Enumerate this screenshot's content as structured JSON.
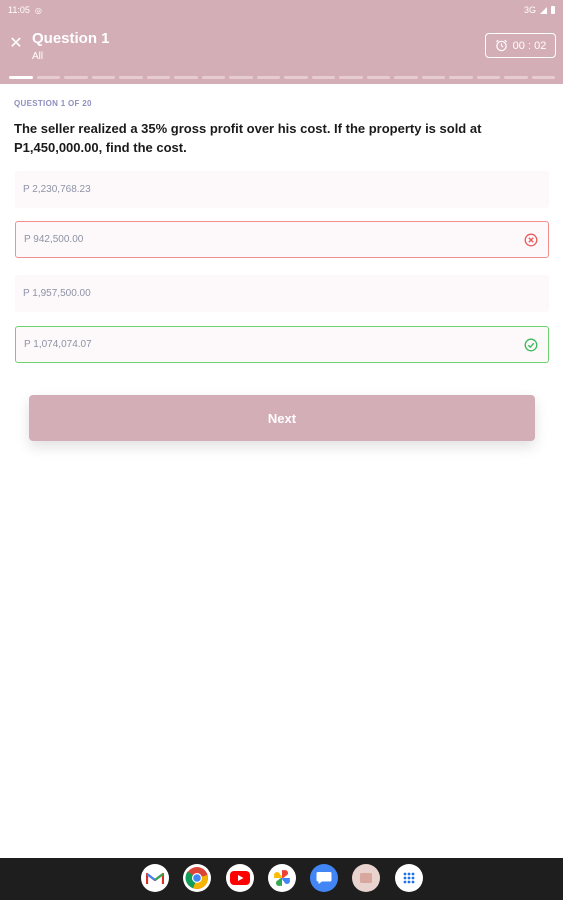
{
  "status_bar": {
    "time": "11:05",
    "network": "3G"
  },
  "header": {
    "title": "Question 1",
    "subtitle": "All",
    "timer": "00 : 02"
  },
  "progress": {
    "current": 1,
    "total": 20
  },
  "question": {
    "counter": "QUESTION 1 OF 20",
    "text": "The seller realized a 35% gross profit over his cost. If the property is sold at P1,450,000.00, find the cost."
  },
  "options": [
    {
      "label": "P 2,230,768.23",
      "state": "neutral"
    },
    {
      "label": "P 942,500.00",
      "state": "wrong"
    },
    {
      "label": "P 1,957,500.00",
      "state": "neutral"
    },
    {
      "label": "P 1,074,074.07",
      "state": "correct"
    }
  ],
  "actions": {
    "next_label": "Next"
  },
  "dock": {
    "apps": [
      "gmail-icon",
      "chrome-icon",
      "youtube-icon",
      "photos-icon",
      "messages-icon",
      "files-icon",
      "app-drawer-icon"
    ]
  },
  "colors": {
    "accent": "#d4aeb7",
    "wrong": "#f29090",
    "correct": "#6dd36d",
    "counter": "#8e8ec0",
    "option_text": "#8e93a6"
  }
}
